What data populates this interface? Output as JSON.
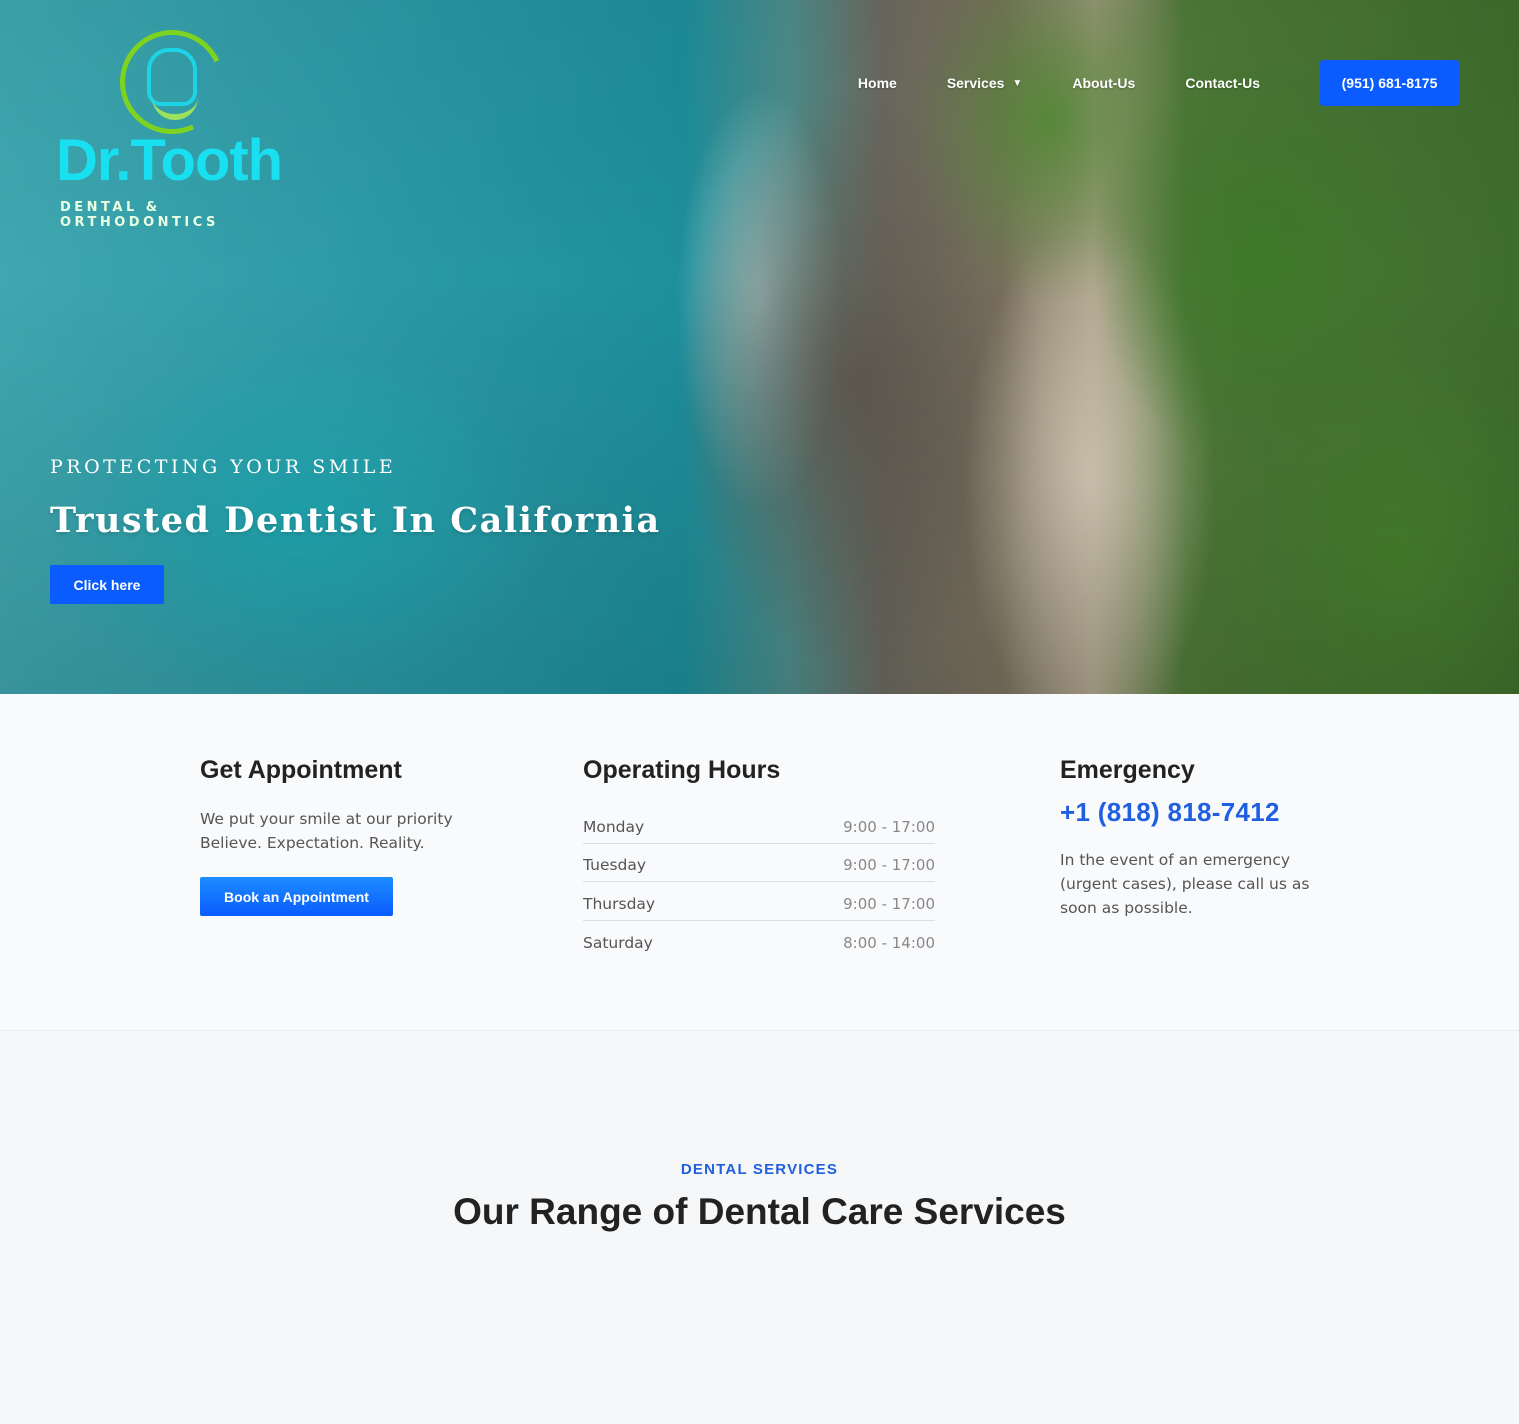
{
  "logo": {
    "text": "Dr.Tooth",
    "subtitle": "DENTAL & ORTHODONTICS"
  },
  "nav": {
    "items": [
      {
        "label": "Home"
      },
      {
        "label": "Services"
      },
      {
        "label": "About-Us"
      },
      {
        "label": "Contact-Us"
      }
    ],
    "phone_button": "(951) 681-8175"
  },
  "hero": {
    "eyebrow": "PROTECTING YOUR SMILE",
    "title": "Trusted Dentist In California",
    "button": "Click here"
  },
  "appointment": {
    "heading": "Get Appointment",
    "line1": "We put your smile at our priority",
    "line2": "Believe. Expectation. Reality.",
    "button": "Book an Appointment"
  },
  "hours": {
    "heading": "Operating Hours",
    "rows": [
      {
        "day": "Monday",
        "time": "9:00 - 17:00"
      },
      {
        "day": "Tuesday",
        "time": "9:00 - 17:00"
      },
      {
        "day": "Thursday",
        "time": "9:00 - 17:00"
      },
      {
        "day": "Saturday",
        "time": "8:00 - 14:00"
      }
    ]
  },
  "emergency": {
    "heading": "Emergency",
    "phone": "+1 (818) 818-7412",
    "text": "In the event of an emergency (urgent cases), please call us as soon as possible."
  },
  "services": {
    "eyebrow": "DENTAL SERVICES",
    "title": "Our Range of Dental Care Services"
  },
  "colors": {
    "primary_blue": "#0a5cff",
    "accent_blue": "#1f5fe0",
    "logo_cyan": "#18e0f0",
    "logo_green": "#7ed321"
  }
}
